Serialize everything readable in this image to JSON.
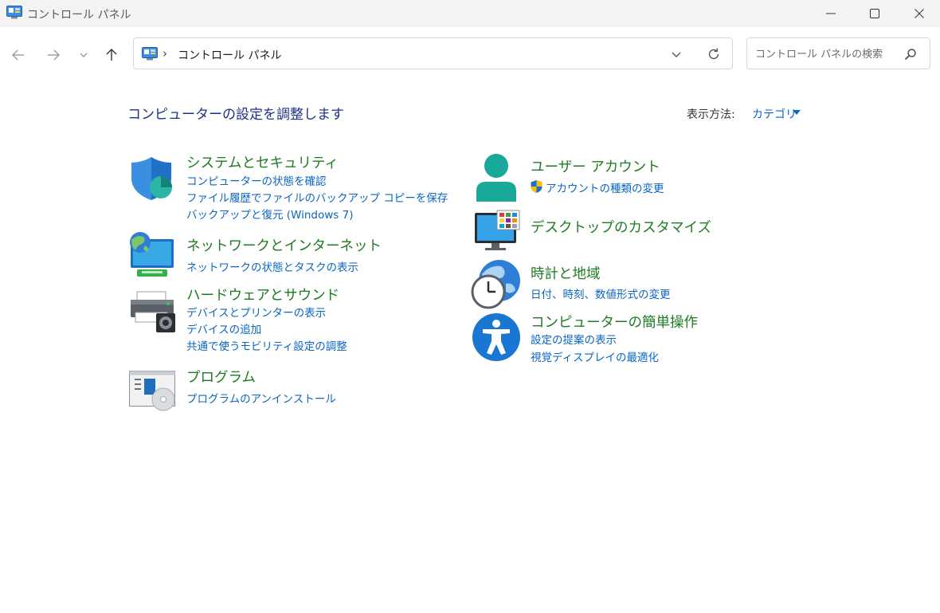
{
  "window": {
    "title": "コントロール パネル"
  },
  "address": {
    "crumb": "コントロール パネル"
  },
  "search": {
    "placeholder": "コントロール パネルの検索"
  },
  "main": {
    "heading": "コンピューターの設定を調整します",
    "view_label": "表示方法:",
    "view_value": "カテゴリ"
  },
  "categories": [
    {
      "title": "システムとセキュリティ",
      "links": [
        "コンピューターの状態を確認",
        "ファイル履歴でファイルのバックアップ コピーを保存",
        "バックアップと復元 (Windows 7)"
      ]
    },
    {
      "title": "ネットワークとインターネット",
      "links": [
        "ネットワークの状態とタスクの表示"
      ]
    },
    {
      "title": "ハードウェアとサウンド",
      "links": [
        "デバイスとプリンターの表示",
        "デバイスの追加",
        "共通で使うモビリティ設定の調整"
      ]
    },
    {
      "title": "プログラム",
      "links": [
        "プログラムのアンインストール"
      ]
    },
    {
      "title": "ユーザー アカウント",
      "links": [
        "アカウントの種類の変更"
      ]
    },
    {
      "title": "デスクトップのカスタマイズ",
      "links": []
    },
    {
      "title": "時計と地域",
      "links": [
        "日付、時刻、数値形式の変更"
      ]
    },
    {
      "title": "コンピューターの簡単操作",
      "links": [
        "設定の提案の表示",
        "視覚ディスプレイの最適化"
      ]
    }
  ]
}
